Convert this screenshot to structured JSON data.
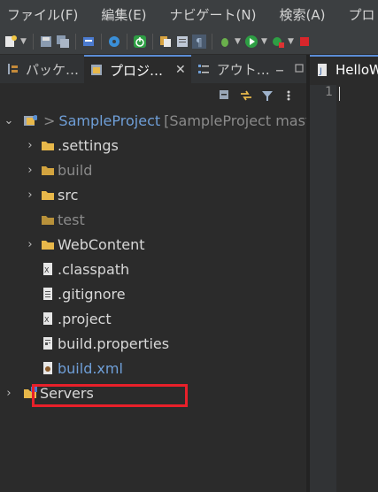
{
  "menu": [
    "ファイル(F)",
    "編集(E)",
    "ナビゲート(N)",
    "検索(A)",
    "プロ"
  ],
  "tabs": [
    {
      "label": "パッケ…",
      "icon": "package-explorer-icon"
    },
    {
      "label": "プロジ…",
      "icon": "project-explorer-icon",
      "active": true
    },
    {
      "label": "アウト…",
      "icon": "outline-icon"
    }
  ],
  "editor_tab": {
    "label": "HelloW"
  },
  "gutter": {
    "line": "1"
  },
  "tree": {
    "project": {
      "name": "SampleProject",
      "decoration": "[SampleProject mast",
      "prefix": ">"
    },
    "items": [
      {
        "label": ".settings",
        "type": "folder",
        "style": "normal",
        "expandable": true
      },
      {
        "label": "build",
        "type": "folder",
        "style": "dim",
        "expandable": true
      },
      {
        "label": "src",
        "type": "folder",
        "style": "normal",
        "expandable": true
      },
      {
        "label": "test",
        "type": "folder",
        "style": "dim",
        "expandable": false
      },
      {
        "label": "WebContent",
        "type": "folder",
        "style": "normal",
        "expandable": true
      },
      {
        "label": ".classpath",
        "type": "xml-file",
        "style": "normal",
        "expandable": false
      },
      {
        "label": ".gitignore",
        "type": "text-file",
        "style": "normal",
        "expandable": false
      },
      {
        "label": ".project",
        "type": "xml-file",
        "style": "normal",
        "expandable": false
      },
      {
        "label": "build.properties",
        "type": "properties-file",
        "style": "normal",
        "expandable": false
      },
      {
        "label": "build.xml",
        "type": "xml-file",
        "style": "link",
        "expandable": false
      }
    ],
    "servers": {
      "label": "Servers"
    }
  },
  "colors": {
    "highlight": "#e8202a",
    "folder": "#e8b84a",
    "link": "#6f9fd8"
  }
}
